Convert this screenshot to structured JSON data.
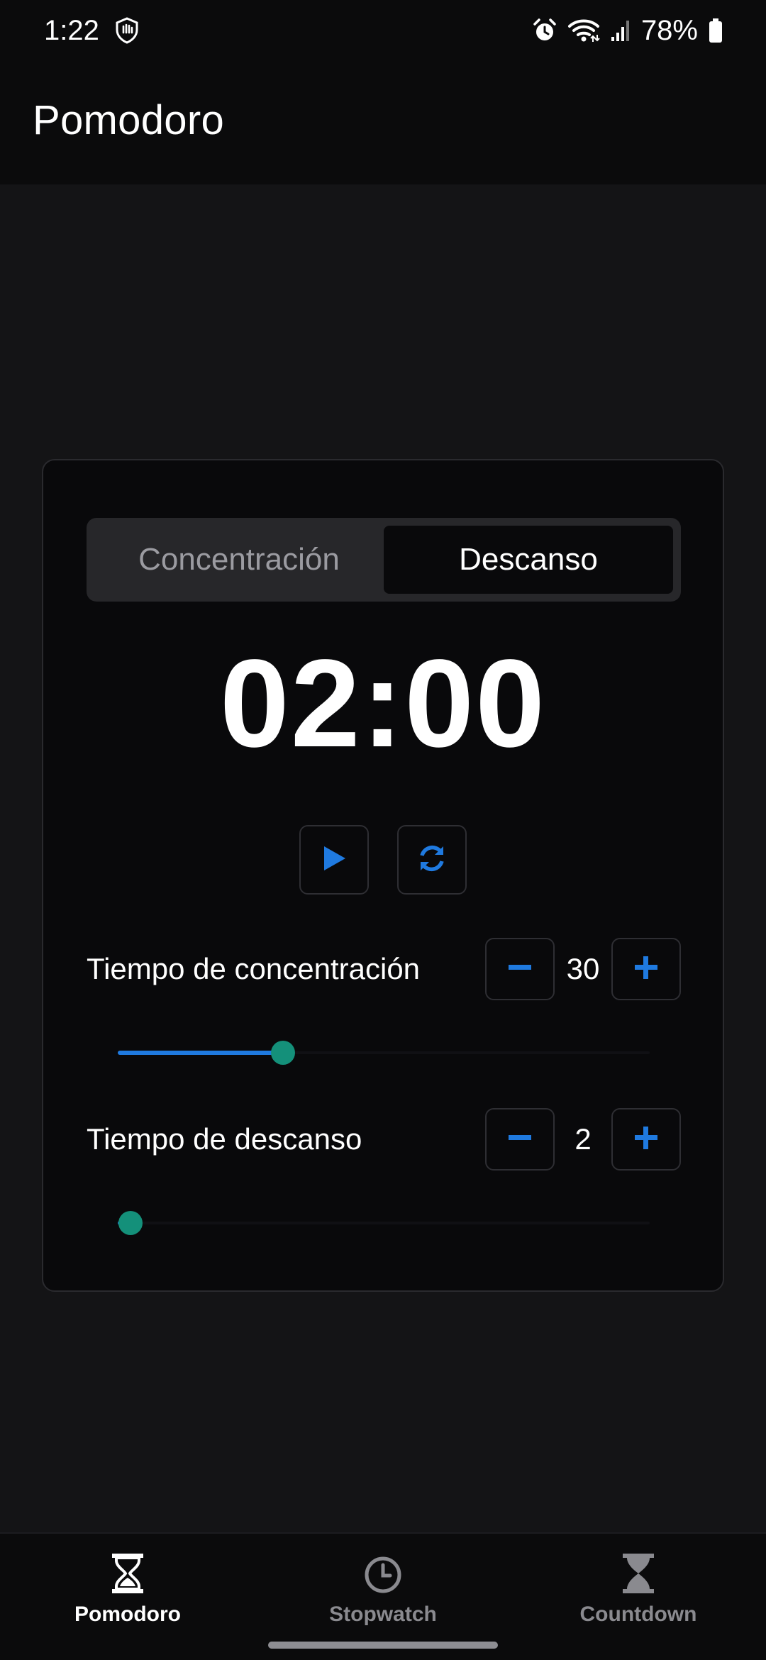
{
  "status_bar": {
    "time": "1:22",
    "battery": "78%",
    "icons": [
      "hand-shield-icon",
      "alarm-icon",
      "wifi-icon",
      "signal-icon",
      "battery-icon"
    ]
  },
  "app_bar": {
    "title": "Pomodoro"
  },
  "card": {
    "tabs": [
      {
        "label": "Concentración",
        "active": false
      },
      {
        "label": "Descanso",
        "active": true
      }
    ],
    "timer": "02:00",
    "controls": {
      "play_icon": "play-icon",
      "reset_icon": "refresh-icon"
    },
    "settings": [
      {
        "label": "Tiempo de concentración",
        "value": "30",
        "slider_fraction": 0.31
      },
      {
        "label": "Tiempo de descanso",
        "value": "2",
        "slider_fraction": 0.024
      }
    ]
  },
  "bottom_nav": {
    "items": [
      {
        "label": "Pomodoro",
        "icon": "hourglass-icon",
        "active": true
      },
      {
        "label": "Stopwatch",
        "icon": "clock-icon",
        "active": false
      },
      {
        "label": "Countdown",
        "icon": "hourglass-icon",
        "active": false
      }
    ]
  },
  "colors": {
    "accent": "#1f7ae0",
    "thumb": "#14907a",
    "background": "#141416",
    "card": "#09090b"
  }
}
